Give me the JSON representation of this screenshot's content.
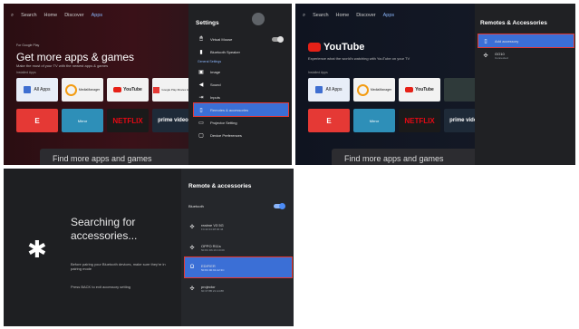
{
  "panel1": {
    "nav": [
      "Search",
      "Home",
      "Discover",
      "Apps"
    ],
    "hero_small": "For Google Play",
    "hero_title": "Get more apps & games",
    "hero_sub": "Make the most of your TV with the newest apps & games",
    "row_label": "Installed Apps",
    "tiles_row1": [
      "All Apps",
      "MediaManager",
      "YouTube",
      "Google Play Movies & TV"
    ],
    "tiles_row2": [
      "E",
      "Mirror",
      "NETFLIX",
      "prime video"
    ],
    "find": "Find more apps and games",
    "settings": {
      "title": "Settings",
      "items_top": [
        {
          "icon": "mouse-icon",
          "label": "Virtual Mouse"
        },
        {
          "icon": "speaker-icon",
          "label": "Bluetooth Speaker"
        }
      ],
      "section": "General Settings",
      "items": [
        {
          "icon": "image-icon",
          "label": "Image"
        },
        {
          "icon": "sound-icon",
          "label": "Sound"
        },
        {
          "icon": "input-icon",
          "label": "Inputs"
        },
        {
          "icon": "remote-icon",
          "label": "Remotes & accessories"
        },
        {
          "icon": "projector-icon",
          "label": "Projector Setting"
        },
        {
          "icon": "tv-icon",
          "label": "Device Preferences"
        }
      ]
    }
  },
  "panel2": {
    "nav": [
      "Search",
      "Home",
      "Discover",
      "Apps"
    ],
    "brand": "YouTube",
    "hero_sub": "Experience what the world's watching with YouTube on your TV",
    "row_label": "Installed Apps",
    "tiles_row1": [
      "All Apps",
      "MediaManager",
      "YouTube"
    ],
    "tiles_row2": [
      "E",
      "Mirror",
      "NETFLIX",
      "prime video"
    ],
    "find": "Find more apps and games",
    "side_title": "Remotes & Accessories",
    "add_label": "Add accessory",
    "device_name": "GO10",
    "device_status": "Connected"
  },
  "panel3": {
    "heading": "Searching for accessories...",
    "hint": "Before pairing your Bluetooth devices, make sure they're in pairing mode",
    "back_hint": "Press BACK to exit accessory setting",
    "side_title": "Remote & accessories",
    "bt_label": "Bluetooth",
    "devices": [
      {
        "name": "realme V3 5G",
        "addr": "F4:42:24:28:40:44"
      },
      {
        "name": "OPPO R11s",
        "addr": "50:8C:D6:16:C0:09"
      },
      {
        "name": "EDIFIER",
        "addr": "50:8C:90:91:A2:3C"
      },
      {
        "name": "projector",
        "addr": "60:37:8B:21:A4:88"
      }
    ]
  }
}
